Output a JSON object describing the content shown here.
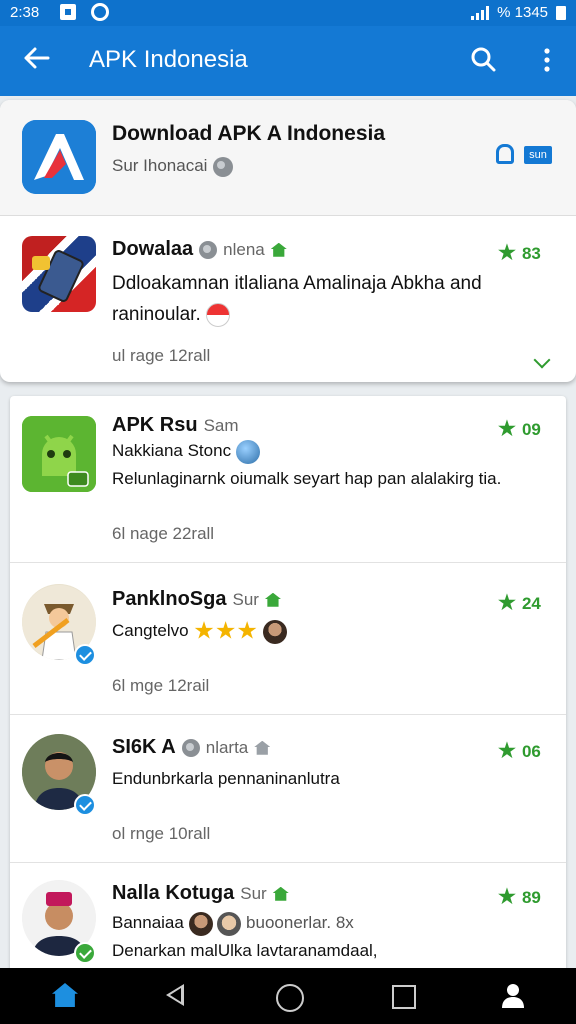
{
  "status_bar": {
    "time": "2:38",
    "right_text": "% 1345"
  },
  "app_bar": {
    "title": "APK Indonesia",
    "back_icon": "arrow-left-icon",
    "search_icon": "search-icon",
    "menu_icon": "more-vert-icon"
  },
  "header_card": {
    "title": "Download APK A Indonesia",
    "subtitle": "Sur Ihonacai",
    "badge": "sun"
  },
  "posts": [
    {
      "name": "Dowalaa",
      "meta": "nlena",
      "rating": "83",
      "body": "Ddloakamnan itlaliana Amalinaja Abkha and raninoular.",
      "footer": "ul  rage  12rall"
    },
    {
      "name": "APK Rsu",
      "meta": "Sam",
      "rating": "09",
      "line1": "Nakkiana Stonc",
      "body": "Relunlaginarnk oiumalk   seyart hap pan alalakirg tia.",
      "footer": "6l  nage  22rall"
    },
    {
      "name": "PanklnoSga",
      "meta": "Sur",
      "rating": "24",
      "body": "Cangtelvo",
      "footer": "6l  mge  12rail"
    },
    {
      "name": "SI6K A",
      "meta": "nlarta",
      "rating": "06",
      "body": "Endunbrkarla pennaninanlutra",
      "footer": "ol  rnge  10rall"
    },
    {
      "name": "Nalla Kotuga",
      "meta": "Sur",
      "rating": "89",
      "line1": "Bannaiaa",
      "line1b": "buoonerlar. 8x",
      "body": "Denarkan malUlka lavtaranamdaal,"
    }
  ],
  "colors": {
    "accent": "#1479d4",
    "rating_green": "#2f9b2f"
  }
}
